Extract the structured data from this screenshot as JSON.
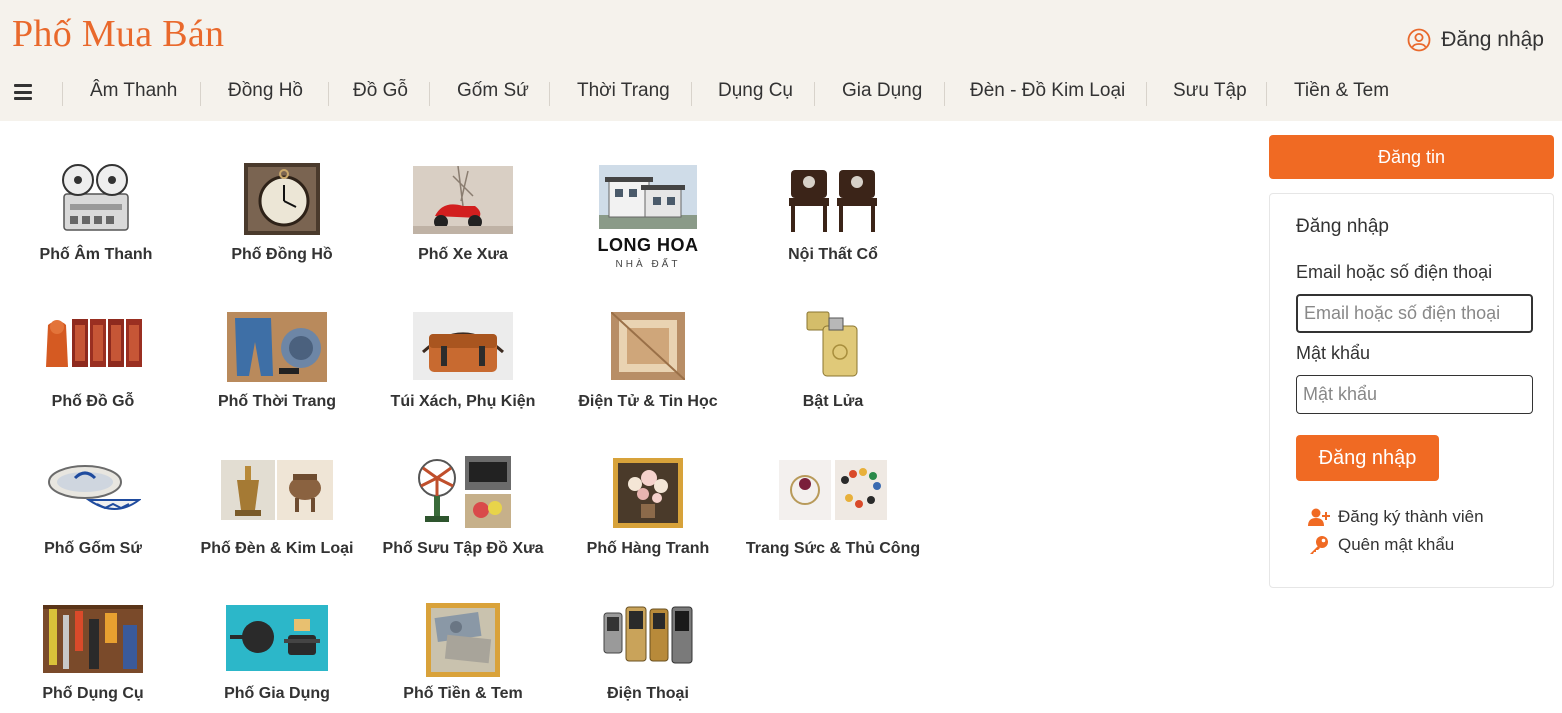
{
  "header": {
    "logo": "Phố Mua Bán",
    "login_label": "Đăng nhập"
  },
  "nav": {
    "items": [
      "Âm Thanh",
      "Đồng Hồ",
      "Đồ Gỗ",
      "Gốm Sứ",
      "Thời Trang",
      "Dụng Cụ",
      "Gia Dụng",
      "Đèn - Đồ Kim Loại",
      "Sưu Tập",
      "Tiền & Tem"
    ]
  },
  "categories": [
    {
      "label": "Phố Âm Thanh",
      "icon": "tape-recorder-image"
    },
    {
      "label": "Phố Đồng Hồ",
      "icon": "pocket-watch-image"
    },
    {
      "label": "Phố Xe Xưa",
      "icon": "vintage-scooter-image"
    },
    {
      "label": "",
      "icon": "long-hoa-logo-image",
      "logo_text": "LONG HOA",
      "logo_sub": "NHÀ ĐẤT"
    },
    {
      "label": "Nội Thất Cổ",
      "icon": "antique-chairs-image"
    },
    {
      "label": "Phố Đồ Gỗ",
      "icon": "wood-carving-image"
    },
    {
      "label": "Phố Thời Trang",
      "icon": "clothes-image"
    },
    {
      "label": "Túi Xách, Phụ Kiện",
      "icon": "leather-bag-image"
    },
    {
      "label": "Điện Tử & Tin Học",
      "icon": "frame-image"
    },
    {
      "label": "Bật Lửa",
      "icon": "lighter-image"
    },
    {
      "label": "Phố Gốm Sứ",
      "icon": "ceramic-bowl-image"
    },
    {
      "label": "Phố Đèn & Kim Loại",
      "icon": "brass-lamp-image"
    },
    {
      "label": "Phố Sưu Tập Đồ Xưa",
      "icon": "vintage-fan-image"
    },
    {
      "label": "Phố Hàng Tranh",
      "icon": "flower-painting-image"
    },
    {
      "label": "Trang Sức & Thủ Công",
      "icon": "jewelry-image"
    },
    {
      "label": "Phố Dụng Cụ",
      "icon": "tools-image"
    },
    {
      "label": "Phố Gia Dụng",
      "icon": "cookware-image"
    },
    {
      "label": "Phố Tiền & Tem",
      "icon": "banknotes-image"
    },
    {
      "label": "Điện Thoại",
      "icon": "mobile-phones-image"
    }
  ],
  "sidebar": {
    "post_button": "Đăng tin",
    "login_title": "Đăng nhập",
    "email_label": "Email hoặc số điện thoại",
    "email_placeholder": "Email hoặc số điện thoại",
    "password_label": "Mật khẩu",
    "password_placeholder": "Mật khẩu",
    "submit_label": "Đăng nhập",
    "register_label": "Đăng ký thành viên",
    "forgot_label": "Quên mật khẩu"
  },
  "colors": {
    "accent": "#f06a23",
    "logo": "#e9692c",
    "header_bg": "#f5f2ec"
  }
}
